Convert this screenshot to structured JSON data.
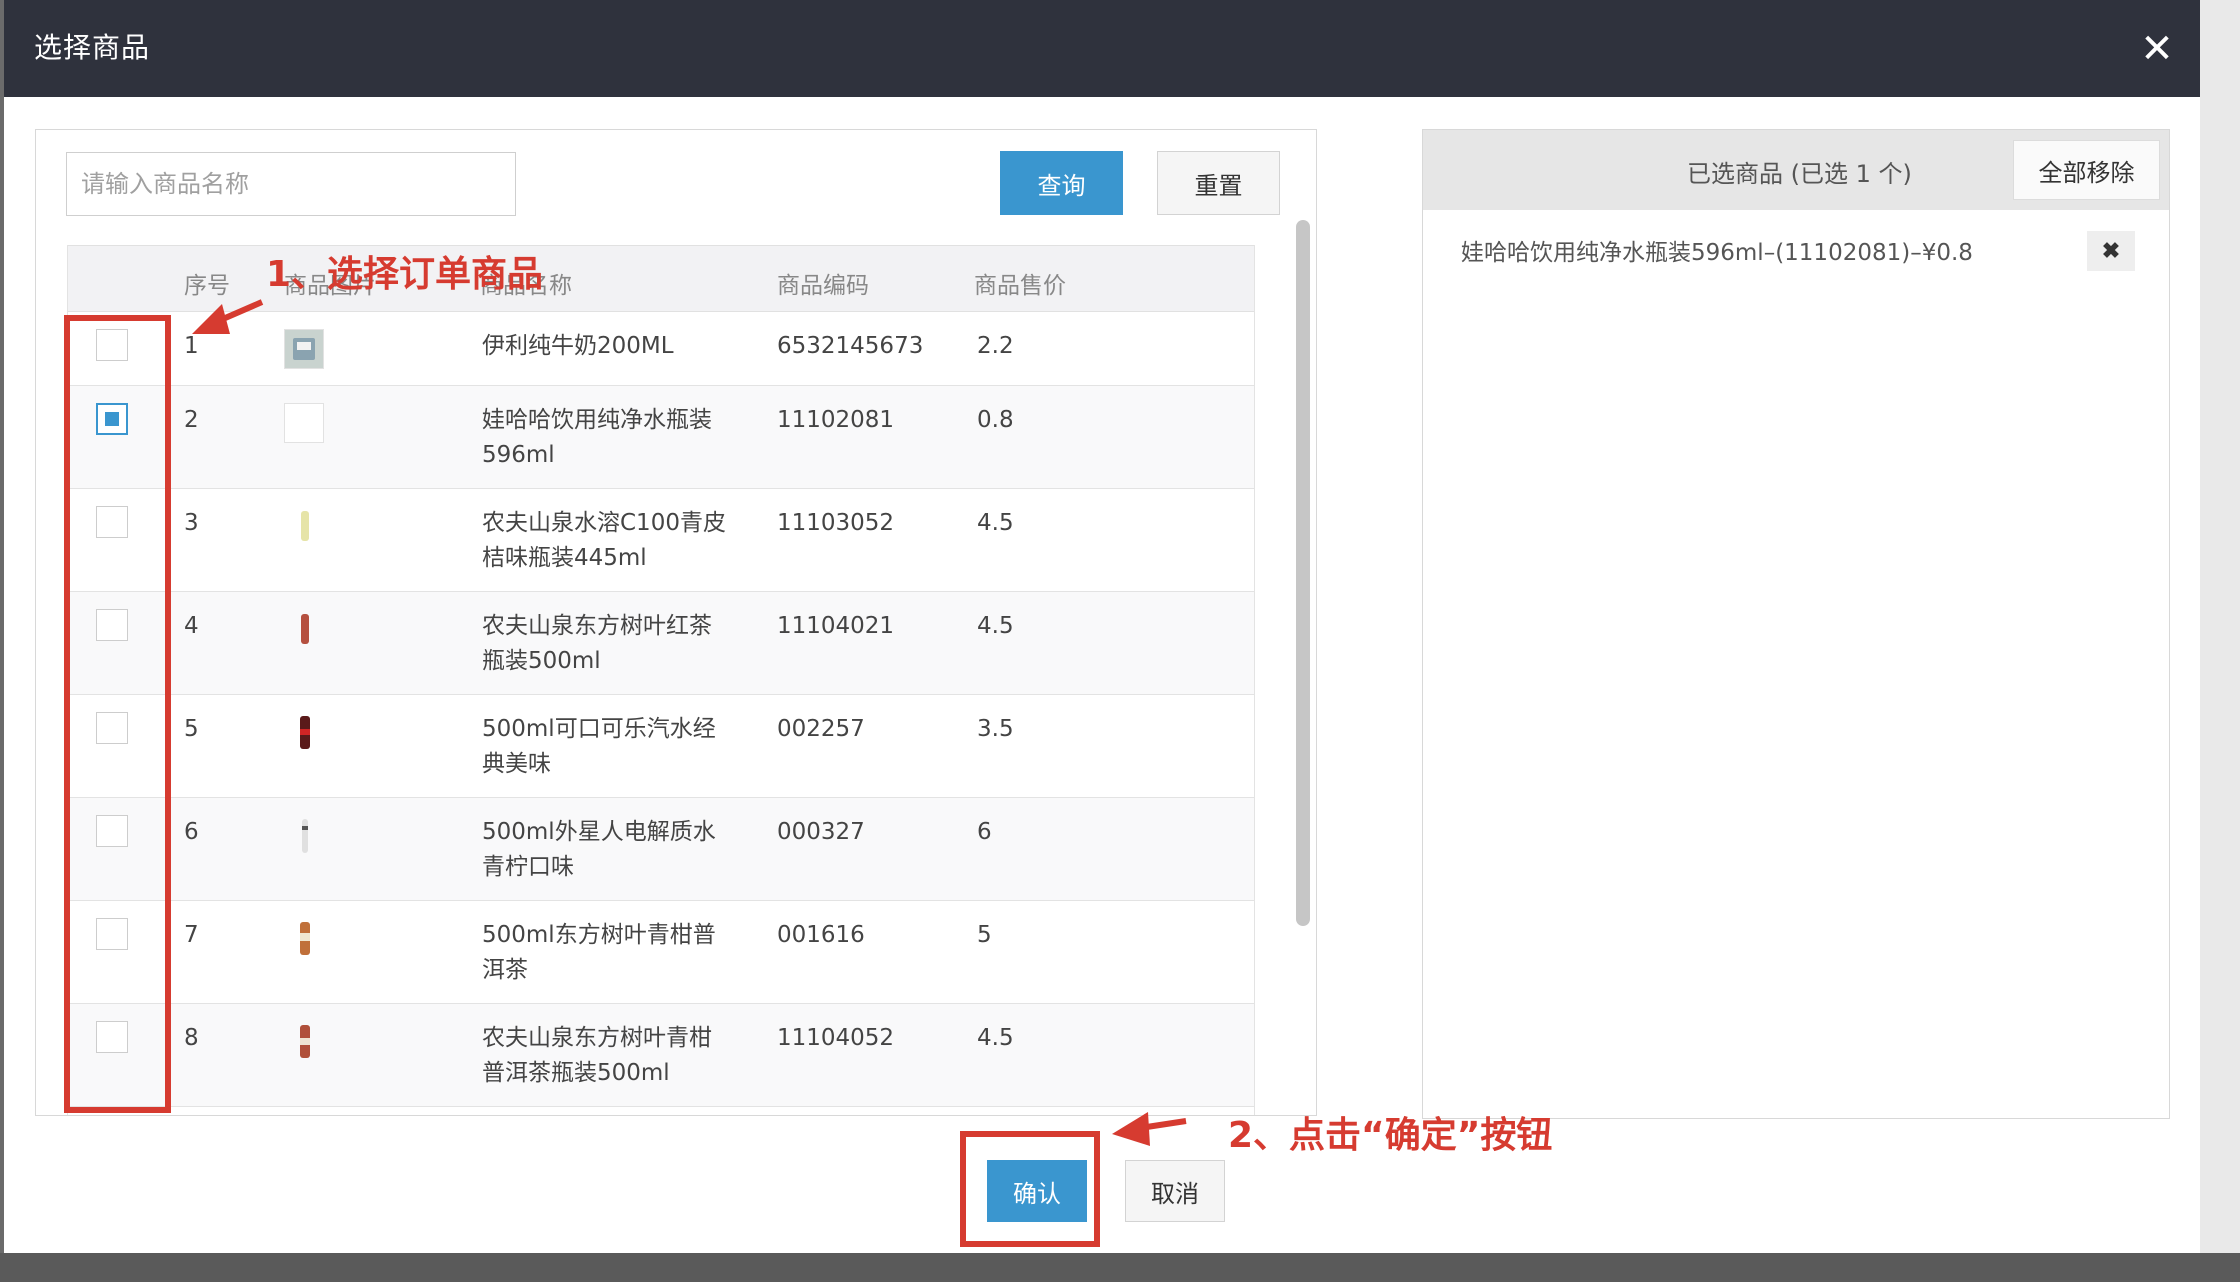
{
  "modal": {
    "title": "选择商品",
    "close_glyph": "✕"
  },
  "search": {
    "placeholder": "请输入商品名称",
    "value": "",
    "search_label": "查询",
    "reset_label": "重置"
  },
  "table": {
    "columns": [
      "序号",
      "商品图片",
      "商品名称",
      "商品编码",
      "商品售价"
    ],
    "rows": [
      {
        "index": "1",
        "name_line1": "伊利纯牛奶200ML",
        "name_line2": "",
        "code": "6532145673",
        "price": "2.2",
        "checked": false,
        "thumb": "milk-box-icon"
      },
      {
        "index": "2",
        "name_line1": "娃哈哈饮用纯净水瓶装",
        "name_line2": "596ml",
        "code": "11102081",
        "price": "0.8",
        "checked": true,
        "thumb": "empty-image-icon"
      },
      {
        "index": "3",
        "name_line1": "农夫山泉水溶C100青皮",
        "name_line2": "桔味瓶装445ml",
        "code": "11103052",
        "price": "4.5",
        "checked": false,
        "thumb": "bottle-icon"
      },
      {
        "index": "4",
        "name_line1": "农夫山泉东方树叶红茶",
        "name_line2": "瓶装500ml",
        "code": "11104021",
        "price": "4.5",
        "checked": false,
        "thumb": "bottle-icon"
      },
      {
        "index": "5",
        "name_line1": "500ml可口可乐汽水经",
        "name_line2": "典美味",
        "code": "002257",
        "price": "3.5",
        "checked": false,
        "thumb": "bottle-icon"
      },
      {
        "index": "6",
        "name_line1": "500ml外星人电解质水",
        "name_line2": "青柠口味",
        "code": "000327",
        "price": "6",
        "checked": false,
        "thumb": "bottle-icon"
      },
      {
        "index": "7",
        "name_line1": "500ml东方树叶青柑普",
        "name_line2": "洱茶",
        "code": "001616",
        "price": "5",
        "checked": false,
        "thumb": "bottle-icon"
      },
      {
        "index": "8",
        "name_line1": "农夫山泉东方树叶青柑",
        "name_line2": "普洱茶瓶装500ml",
        "code": "11104052",
        "price": "4.5",
        "checked": false,
        "thumb": "bottle-icon"
      }
    ]
  },
  "selected": {
    "title": "已选商品 (已选 1 个)",
    "remove_all_label": "全部移除",
    "items": [
      {
        "text": "娃哈哈饮用纯净水瓶装596ml–(11102081)–¥0.8",
        "remove_glyph": "✖"
      }
    ]
  },
  "footer": {
    "confirm_label": "确认",
    "cancel_label": "取消"
  },
  "annotations": {
    "step1": "1、选择订单商品",
    "step2": "2、点击“确定”按钮"
  },
  "colors": {
    "header_bg": "#2f323d",
    "primary": "#3a96cf",
    "annotation_red": "#d63b30"
  }
}
